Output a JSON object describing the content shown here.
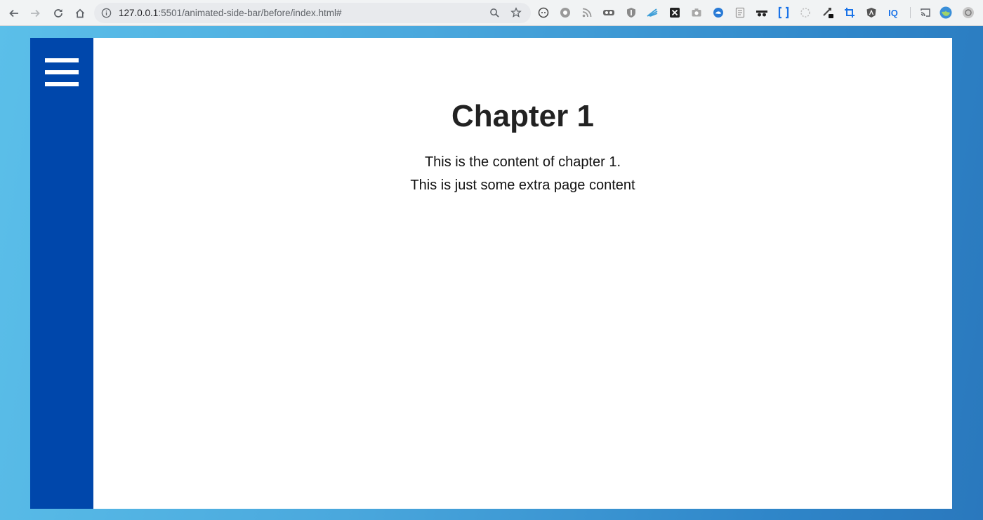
{
  "browser": {
    "url_host": "127.0.0.1",
    "url_path": ":5501/animated-side-bar/before/index.html#",
    "omnibox_icons": [
      "zoom-icon",
      "bookmark-star-icon"
    ],
    "extensions": [
      "reader-extension-icon",
      "ghostery-extension-icon",
      "rss-extension-icon",
      "tampermonkey-extension-icon",
      "ublock-extension-icon",
      "feedly-extension-icon",
      "x-extension-icon",
      "screenshot-extension-icon",
      "edge-extension-icon",
      "notes-extension-icon",
      "incognito-extension-icon",
      "brackets-extension-icon",
      "loading-extension-icon",
      "eyedropper-extension-icon",
      "crop-extension-icon",
      "angular-extension-icon",
      "iq-extension-icon",
      "cast-icon",
      "profile-avatar-icon",
      "menu-icon"
    ],
    "ext_iq_label": "IQ",
    "ext_x_label": "X"
  },
  "page": {
    "heading": "Chapter 1",
    "paragraph_1": "This is the content of chapter 1.",
    "paragraph_2": "This is just some extra page content"
  },
  "colors": {
    "sidebar": "#0047ab",
    "viewport_background": "#4aa8dd",
    "content_background": "#ffffff"
  }
}
